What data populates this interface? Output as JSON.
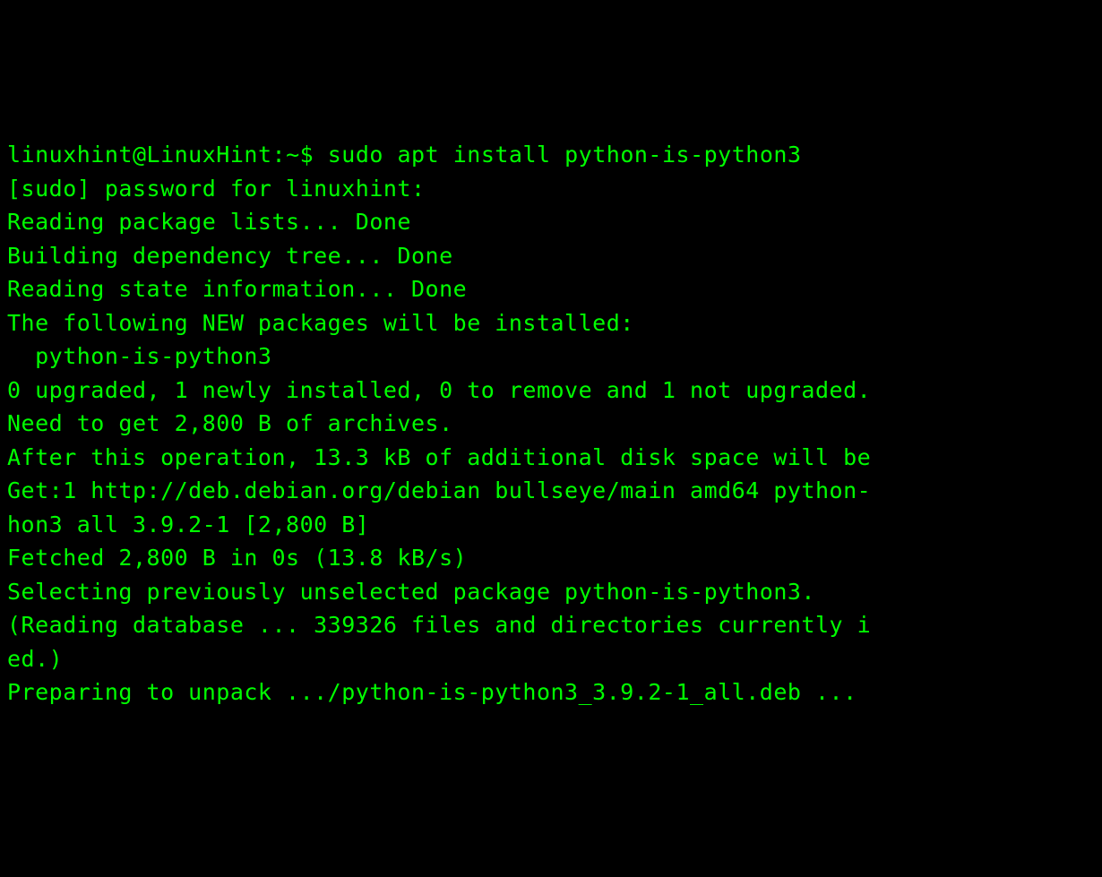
{
  "terminal": {
    "prompt": {
      "user": "linuxhint",
      "at": "@",
      "host": "LinuxHint",
      "colon": ":",
      "path": "~",
      "symbol": "$"
    },
    "command": "sudo apt install python-is-python3",
    "output": {
      "line1": "[sudo] password for linuxhint:",
      "line2": "Reading package lists... Done",
      "line3": "Building dependency tree... Done",
      "line4": "Reading state information... Done",
      "line5": "The following NEW packages will be installed:",
      "line6": "  python-is-python3",
      "line7": "0 upgraded, 1 newly installed, 0 to remove and 1 not upgraded.",
      "line8": "Need to get 2,800 B of archives.",
      "line9": "After this operation, 13.3 kB of additional disk space will be",
      "line10": "Get:1 http://deb.debian.org/debian bullseye/main amd64 python-",
      "line11": "hon3 all 3.9.2-1 [2,800 B]",
      "line12": "Fetched 2,800 B in 0s (13.8 kB/s)",
      "line13": "Selecting previously unselected package python-is-python3.",
      "line14": "(Reading database ... 339326 files and directories currently i",
      "line15": "ed.)",
      "line16": "Preparing to unpack .../python-is-python3_3.9.2-1_all.deb ..."
    }
  }
}
